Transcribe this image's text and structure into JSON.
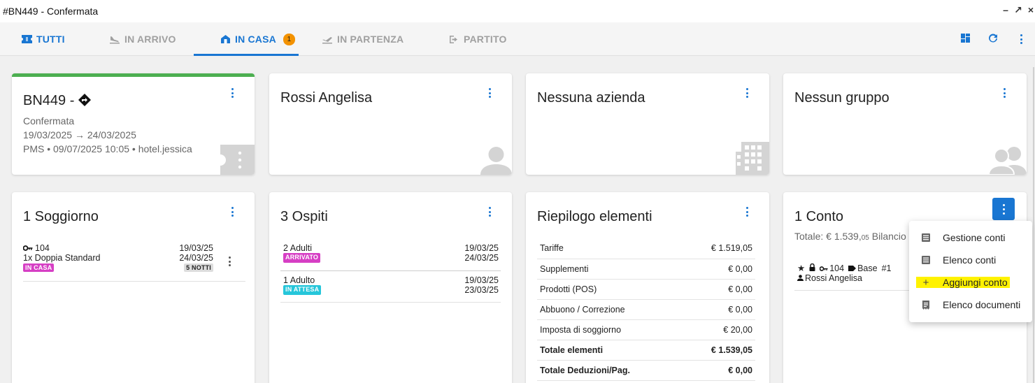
{
  "window": {
    "title": "#BN449 - Confermata"
  },
  "tabs": [
    {
      "label": "TUTTI",
      "icon": "ticket-icon",
      "state": "link"
    },
    {
      "label": "IN ARRIVO",
      "icon": "plane-landing-icon",
      "state": "disabled"
    },
    {
      "label": "IN CASA",
      "icon": "home-icon",
      "state": "active",
      "badge": "1"
    },
    {
      "label": "IN PARTENZA",
      "icon": "plane-departure-icon",
      "state": "disabled"
    },
    {
      "label": "PARTITO",
      "icon": "exit-icon",
      "state": "disabled"
    }
  ],
  "booking": {
    "title": "BN449 -",
    "status": "Confermata",
    "dates": "19/03/2025 → 24/03/2025",
    "source": "PMS • 09/07/2025 10:05 • hotel.jessica"
  },
  "guest": {
    "name": "Rossi Angelisa"
  },
  "company": {
    "name": "Nessuna azienda"
  },
  "group": {
    "name": "Nessun gruppo"
  },
  "stays": {
    "title": "1 Soggiorno",
    "items": [
      {
        "room": "104",
        "room_type": "1x Doppia Standard",
        "status": "IN CASA",
        "arrival": "19/03/25",
        "departure": "24/03/25",
        "nights": "5 NOTTI"
      }
    ]
  },
  "guests": {
    "title": "3 Ospiti",
    "items": [
      {
        "label": "2 Adulti",
        "status": "ARRIVATO",
        "from": "19/03/25",
        "to": "24/03/25"
      },
      {
        "label": "1 Adulto",
        "status": "IN ATTESA",
        "from": "19/03/25",
        "to": "23/03/25"
      }
    ]
  },
  "summary": {
    "title": "Riepilogo elementi",
    "rows": [
      {
        "label": "Tariffe",
        "value": "€ 1.519,05"
      },
      {
        "label": "Supplementi",
        "value": "€ 0,00"
      },
      {
        "label": "Prodotti (POS)",
        "value": "€ 0,00"
      },
      {
        "label": "Abbuono / Correzione",
        "value": "€ 0,00"
      },
      {
        "label": "Imposta di soggiorno",
        "value": "€ 20,00"
      },
      {
        "label": "Totale elementi",
        "value": "€ 1.539,05"
      },
      {
        "label": "Totale Deduzioni/Pag.",
        "value": "€ 0,00"
      }
    ]
  },
  "accounts": {
    "title": "1 Conto",
    "total_prefix": "Totale: € 1.539,",
    "total_cents": "05",
    "balance_label": "Bilancio",
    "room": "104",
    "type": "Base",
    "number": "#1",
    "holder": "Rossi Angelisa"
  },
  "menu": {
    "items": [
      {
        "label": "Gestione conti"
      },
      {
        "label": "Elenco conti"
      },
      {
        "label": "Aggiungi conto"
      },
      {
        "label": "Elenco documenti"
      }
    ]
  },
  "colors": {
    "accent": "#1976d2",
    "green": "#4caf50",
    "badge": "#f39200",
    "pink": "#d63fc4",
    "cyan": "#26c6da",
    "highlight": "#fff200"
  }
}
